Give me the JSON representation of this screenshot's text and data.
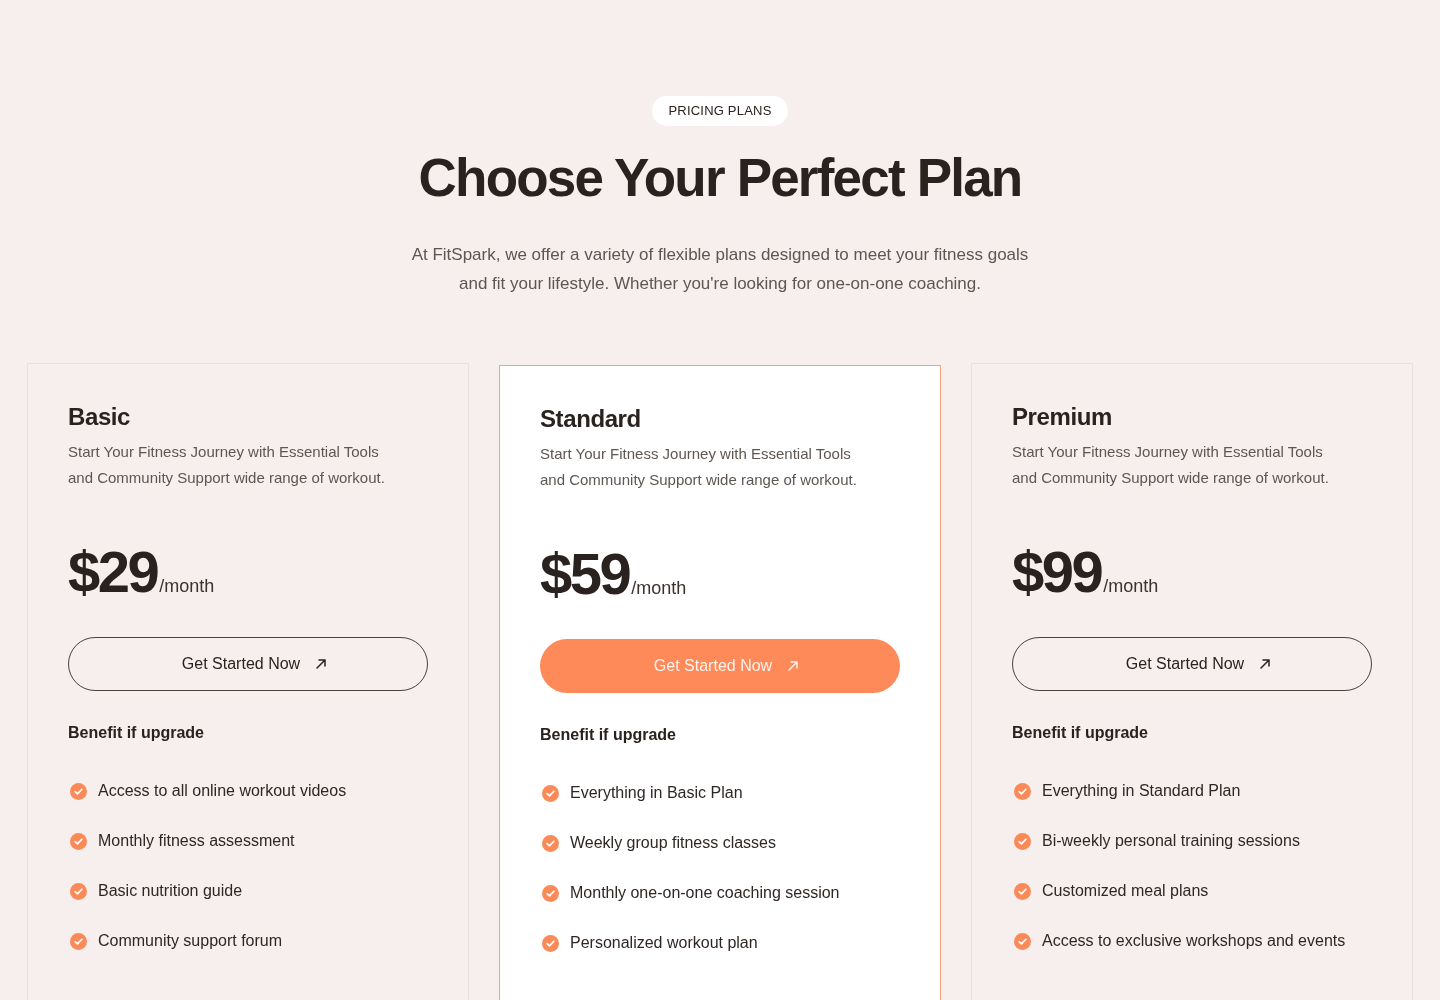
{
  "badge": "PRICING PLANS",
  "title": "Choose Your Perfect Plan",
  "subtitle": "At FitSpark, we offer a variety of flexible plans designed to meet your fitness goals and fit your lifestyle. Whether you're looking for one-on-one coaching.",
  "plans": [
    {
      "name": "Basic",
      "featured": false,
      "description": "Start Your Fitness Journey with Essential Tools and Community Support wide range of workout.",
      "price": "$29",
      "period": "/month",
      "button": "Get Started Now",
      "benefits_title": "Benefit if upgrade",
      "benefits": [
        "Access to all online workout videos",
        "Monthly fitness assessment",
        "Basic nutrition guide",
        "Community support forum"
      ]
    },
    {
      "name": "Standard",
      "featured": true,
      "description": "Start Your Fitness Journey with Essential Tools and Community Support wide range of workout.",
      "price": "$59",
      "period": "/month",
      "button": "Get Started Now",
      "benefits_title": "Benefit if upgrade",
      "benefits": [
        "Everything in Basic Plan",
        "Weekly group fitness classes",
        "Monthly one-on-one coaching session",
        "Personalized workout plan"
      ]
    },
    {
      "name": "Premium",
      "featured": false,
      "description": "Start Your Fitness Journey with Essential Tools and Community Support wide range of workout.",
      "price": "$99",
      "period": "/month",
      "button": "Get Started Now",
      "benefits_title": "Benefit if upgrade",
      "benefits": [
        "Everything in Standard Plan",
        "Bi-weekly personal training sessions",
        "Customized meal plans",
        "Access to exclusive workshops and events"
      ]
    }
  ]
}
